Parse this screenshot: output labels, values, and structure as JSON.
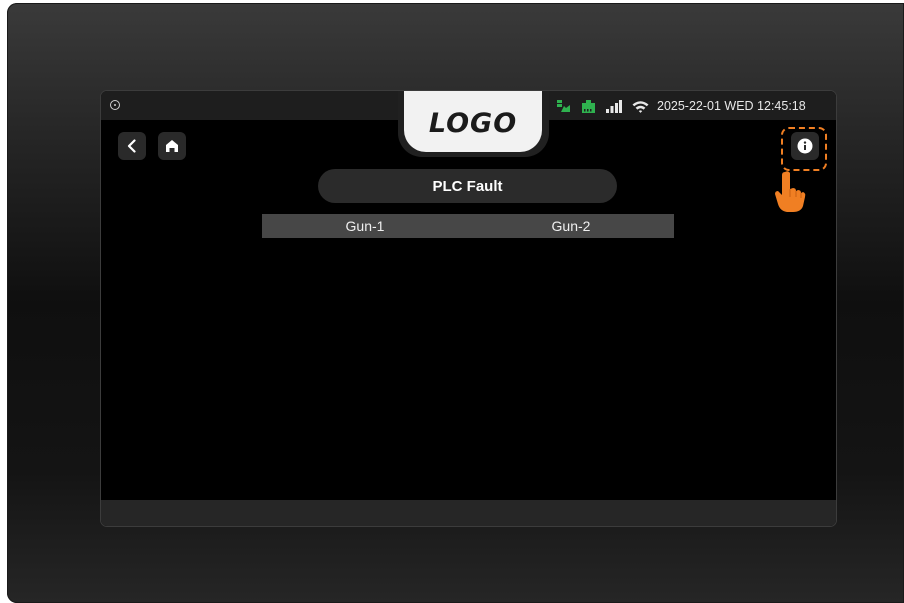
{
  "brand": {
    "logo_text": "LOGO"
  },
  "status_bar": {
    "datetime": "2025-22-01 WED 12:45:18",
    "icons": [
      "camera-icon",
      "charger-icon",
      "network-port-icon",
      "signal-icon",
      "wifi-icon"
    ],
    "colors": {
      "connected": "#2fb24f",
      "text": "#e8e8e8"
    }
  },
  "navigation": {
    "back_icon": "chevron-left-icon",
    "home_icon": "home-icon",
    "info_icon": "info-icon"
  },
  "page": {
    "title": "PLC Fault"
  },
  "fault_table": {
    "columns": [
      "Gun-1",
      "Gun-2"
    ]
  },
  "annotation": {
    "highlight_color": "#f07f23",
    "pointer_icon": "hand-pointer-icon"
  }
}
